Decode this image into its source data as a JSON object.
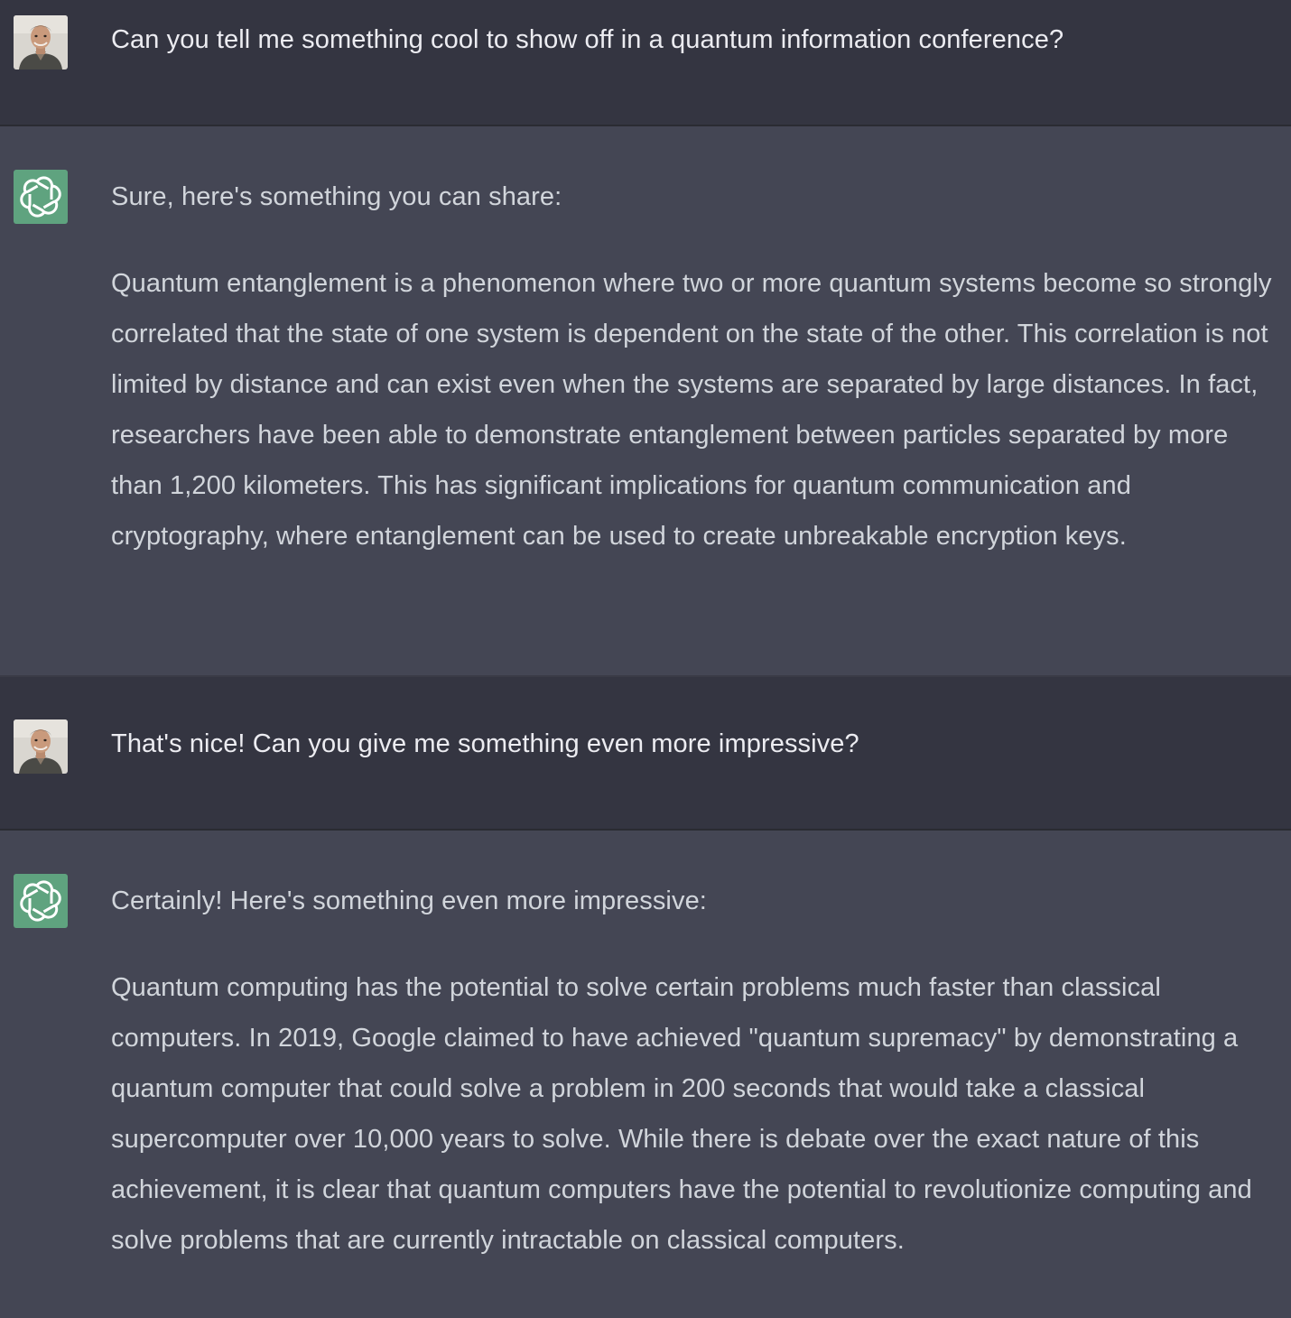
{
  "conversation": {
    "messages": [
      {
        "role": "user",
        "avatar_icon": "user-avatar-photo",
        "paragraphs": [
          "Can you tell me something cool to show off in a quantum information conference?"
        ]
      },
      {
        "role": "assistant",
        "avatar_icon": "openai-logo-icon",
        "paragraphs": [
          "Sure, here's something you can share:",
          "Quantum entanglement is a phenomenon where two or more quantum systems become so strongly correlated that the state of one system is dependent on the state of the other. This correlation is not limited by distance and can exist even when the systems are separated by large distances. In fact, researchers have been able to demonstrate entanglement between particles separated by more than 1,200 kilometers. This has significant implications for quantum communication and cryptography, where entanglement can be used to create unbreakable encryption keys."
        ]
      },
      {
        "role": "user",
        "avatar_icon": "user-avatar-photo",
        "paragraphs": [
          "That's nice! Can you give me something even more impressive?"
        ]
      },
      {
        "role": "assistant",
        "avatar_icon": "openai-logo-icon",
        "paragraphs": [
          "Certainly! Here's something even more impressive:",
          "Quantum computing has the potential to solve certain problems much faster than classical computers. In 2019, Google claimed to have achieved \"quantum supremacy\" by demonstrating a quantum computer that could solve a problem in 200 seconds that would take a classical supercomputer over 10,000 years to solve. While there is debate over the exact nature of this achievement, it is clear that quantum computers have the potential to revolutionize computing and solve problems that are currently intractable on classical computers."
        ]
      }
    ]
  },
  "colors": {
    "user_bg": "#343541",
    "assistant_bg": "#444654",
    "assistant_avatar_bg": "#5fa37f",
    "text": "#d1d5db"
  }
}
